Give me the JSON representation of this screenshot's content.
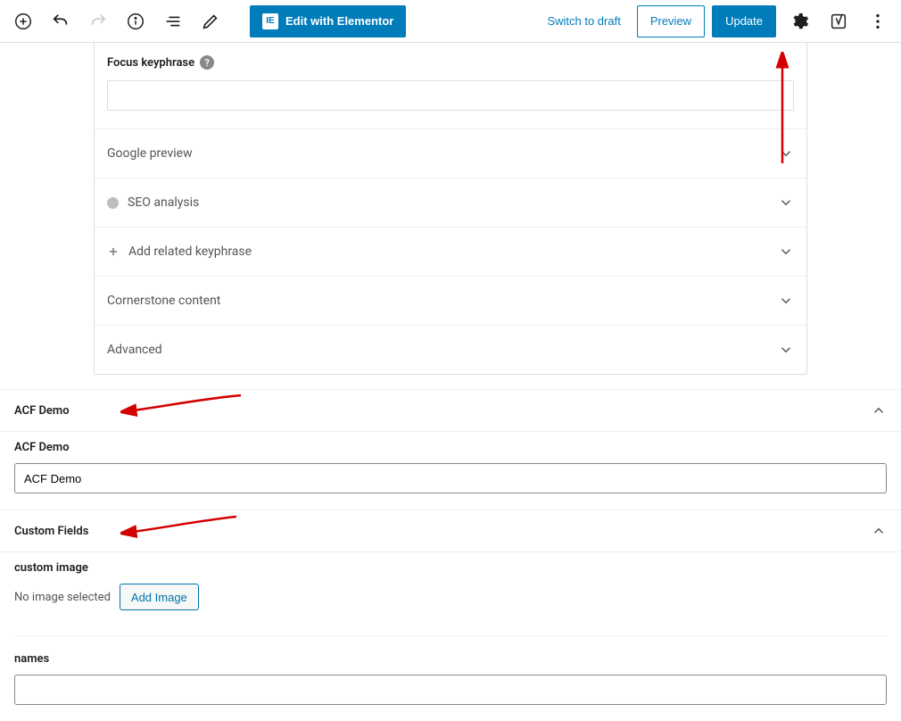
{
  "toolbar": {
    "elementor_label": "Edit with Elementor",
    "draft_label": "Switch to draft",
    "preview_label": "Preview",
    "update_label": "Update"
  },
  "yoast": {
    "focus_label": "Focus keyphrase",
    "keyword_value": "",
    "rows": {
      "google_preview": "Google preview",
      "seo_analysis": "SEO analysis",
      "add_keyphrase": "Add related keyphrase",
      "cornerstone": "Cornerstone content",
      "advanced": "Advanced"
    }
  },
  "acf_panel": {
    "header": "ACF Demo",
    "field_label": "ACF Demo",
    "field_value": "ACF Demo"
  },
  "cf_panel": {
    "header": "Custom Fields",
    "image_label": "custom image",
    "image_empty_text": "No image selected",
    "add_image_label": "Add Image",
    "names_label": "names",
    "names_value": ""
  }
}
